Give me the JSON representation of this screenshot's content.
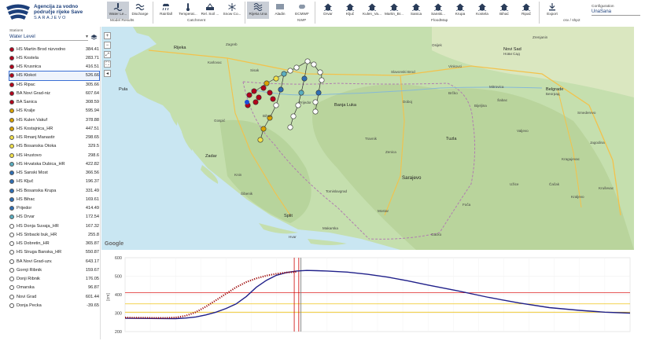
{
  "header": {
    "logo_line1": "Agencija za vodno",
    "logo_line2": "područje rijeke Save",
    "logo_sub": "SARAJEVO",
    "config_label": "Configuration",
    "config_value": "UnaSana"
  },
  "toolbar": {
    "buttons": [
      {
        "label": "Water Le...",
        "icon": "water-level-icon",
        "active": true
      },
      {
        "label": "Discharge",
        "icon": "discharge-icon",
        "active": false
      },
      {
        "label": "Rainfall",
        "icon": "rainfall-icon",
        "active": false
      },
      {
        "label": "Temperat...",
        "icon": "thermometer-icon",
        "active": false
      },
      {
        "label": "Rel. Soil ...",
        "icon": "soil-icon",
        "active": false
      },
      {
        "label": "Snow Co...",
        "icon": "snow-icon",
        "active": false
      },
      {
        "label": "Rijeka Una",
        "icon": "river-icon",
        "active": true
      },
      {
        "label": "Aladin",
        "icon": "aladin-icon",
        "active": false
      },
      {
        "label": "ECMWF",
        "icon": "ecmwf-icon",
        "active": false
      },
      {
        "label": "Drvar",
        "icon": "house-icon",
        "active": false
      },
      {
        "label": "Ključ",
        "icon": "house-icon",
        "active": false
      },
      {
        "label": "Kulen_Va...",
        "icon": "house-icon",
        "active": false
      },
      {
        "label": "Martin_Br...",
        "icon": "house-icon",
        "active": false
      },
      {
        "label": "Sanica",
        "icon": "house-icon",
        "active": false
      },
      {
        "label": "Sanski...",
        "icon": "house-icon",
        "active": false
      },
      {
        "label": "Krupa",
        "icon": "house-icon",
        "active": false
      },
      {
        "label": "Kostela",
        "icon": "house-icon",
        "active": false
      },
      {
        "label": "Bihać",
        "icon": "house-icon",
        "active": false
      },
      {
        "label": "Ripač",
        "icon": "house-icon",
        "active": false
      },
      {
        "label": "Export",
        "icon": "download-icon",
        "active": false
      }
    ],
    "groups": [
      "Model Results",
      "Catchment",
      "NWP",
      "FloodMap",
      "csv / shp2"
    ]
  },
  "sidebar": {
    "label": "Stations",
    "selected_type": "Water Level",
    "stations": [
      {
        "name": "HS Martin Brod nizvodno",
        "value": "384.41",
        "color": "#b3001b"
      },
      {
        "name": "HS Kostela",
        "value": "283.71",
        "color": "#b3001b"
      },
      {
        "name": "HS Krusnica",
        "value": "416.51",
        "color": "#b3001b"
      },
      {
        "name": "HS Klokot",
        "value": "526.66",
        "color": "#b3001b",
        "selected": true
      },
      {
        "name": "HS Ripac",
        "value": "305.66",
        "color": "#b3001b"
      },
      {
        "name": "BA Novi Grad-niz",
        "value": "607.64",
        "color": "#b3001b"
      },
      {
        "name": "BA Sanica",
        "value": "308.59",
        "color": "#b3001b"
      },
      {
        "name": "HS Kralje",
        "value": "595.94",
        "color": "#d9a200"
      },
      {
        "name": "HS Kulen Vakuf",
        "value": "378.88",
        "color": "#d9a200"
      },
      {
        "name": "HS Kostajnica_HR",
        "value": "447.51",
        "color": "#d9a200"
      },
      {
        "name": "HS Rmanj Manastir",
        "value": "298.65",
        "color": "#f1e04a"
      },
      {
        "name": "HS Bosanska Otoka",
        "value": "329.5",
        "color": "#f1e04a"
      },
      {
        "name": "HS Hrustovo",
        "value": "298.6",
        "color": "#f1e04a"
      },
      {
        "name": "HS Hrvatska Dubica_HR",
        "value": "422.82",
        "color": "#5aaec0"
      },
      {
        "name": "HS Sanski Most",
        "value": "366.56",
        "color": "#2f6fb5"
      },
      {
        "name": "HS Ključ",
        "value": "196.37",
        "color": "#2f6fb5"
      },
      {
        "name": "HS Bosanska Krupa",
        "value": "331.49",
        "color": "#2f6fb5"
      },
      {
        "name": "HS Bihac",
        "value": "169.61",
        "color": "#2f6fb5"
      },
      {
        "name": "Prijedor",
        "value": "414.49",
        "color": "#2f6fb5"
      },
      {
        "name": "HS Drvar",
        "value": "172.54",
        "color": "#5aaec0"
      },
      {
        "name": "HS Donja Suvaja_HR",
        "value": "167.32",
        "color": "#ffffff"
      },
      {
        "name": "HS Strbacki buk_HR",
        "value": "255.8",
        "color": "#ffffff"
      },
      {
        "name": "HS Dobretin_HR",
        "value": "365.87",
        "color": "#ffffff"
      },
      {
        "name": "HS Struga Banska_HR",
        "value": "550.87",
        "color": "#ffffff"
      },
      {
        "name": "BA Novi Grad-uzv.",
        "value": "643.17",
        "color": "#ffffff"
      },
      {
        "name": "Gornji Ribnik",
        "value": "159.67",
        "color": "#ffffff"
      },
      {
        "name": "Donji Ribnik",
        "value": "176.05",
        "color": "#ffffff"
      },
      {
        "name": "Omarska",
        "value": "96.87",
        "color": "#ffffff"
      },
      {
        "name": "Novi Grad",
        "value": "601.44",
        "color": "#ffffff"
      },
      {
        "name": "Donja Pecka",
        "value": "-39.65",
        "color": "#ffffff"
      }
    ]
  },
  "map": {
    "controls": [
      "+",
      "−",
      "⤢",
      "⛶",
      "◂"
    ],
    "labels": [
      {
        "t": "Rijeka",
        "x": 92,
        "y": 24,
        "c": "big"
      },
      {
        "t": "Pula",
        "x": 22,
        "y": 77,
        "c": "big"
      },
      {
        "t": "Zadar",
        "x": 132,
        "y": 162,
        "c": "big"
      },
      {
        "t": "Split",
        "x": 232,
        "y": 238,
        "c": "big"
      },
      {
        "t": "Banja Luka",
        "x": 296,
        "y": 97,
        "c": "big"
      },
      {
        "t": "Sarajevo",
        "x": 382,
        "y": 189,
        "c": "city"
      },
      {
        "t": "Novi Sad",
        "x": 511,
        "y": 26,
        "c": "big"
      },
      {
        "t": "Нови Сад",
        "x": 511,
        "y": 32,
        "c": ""
      },
      {
        "t": "Belgrade",
        "x": 565,
        "y": 77,
        "c": "big"
      },
      {
        "t": "Београд",
        "x": 565,
        "y": 83,
        "c": ""
      },
      {
        "t": "Zrenjanin",
        "x": 548,
        "y": 11,
        "c": ""
      },
      {
        "t": "Tuzla",
        "x": 438,
        "y": 140,
        "c": "big"
      },
      {
        "t": "Zenica",
        "x": 361,
        "y": 157,
        "c": ""
      },
      {
        "t": "Mostar",
        "x": 351,
        "y": 232,
        "c": ""
      },
      {
        "t": "Kragujevac",
        "x": 585,
        "y": 166,
        "c": ""
      },
      {
        "t": "Čačak",
        "x": 569,
        "y": 198,
        "c": ""
      },
      {
        "t": "Šabac",
        "x": 503,
        "y": 91,
        "c": ""
      },
      {
        "t": "Valjevo",
        "x": 528,
        "y": 130,
        "c": ""
      },
      {
        "t": "Bijeljina",
        "x": 474,
        "y": 98,
        "c": ""
      },
      {
        "t": "Brčko",
        "x": 441,
        "y": 82,
        "c": ""
      },
      {
        "t": "Doboj",
        "x": 383,
        "y": 93,
        "c": ""
      },
      {
        "t": "Prijedor",
        "x": 251,
        "y": 94,
        "c": ""
      },
      {
        "t": "Bihać",
        "x": 205,
        "y": 111,
        "c": ""
      },
      {
        "t": "Travnik",
        "x": 335,
        "y": 140,
        "c": ""
      },
      {
        "t": "Knin",
        "x": 169,
        "y": 186,
        "c": ""
      },
      {
        "t": "Šibenik",
        "x": 177,
        "y": 210,
        "c": ""
      },
      {
        "t": "Tomislavgrad",
        "x": 285,
        "y": 207,
        "c": ""
      },
      {
        "t": "Kraljevo",
        "x": 597,
        "y": 214,
        "c": ""
      },
      {
        "t": "Užice",
        "x": 519,
        "y": 198,
        "c": ""
      },
      {
        "t": "Osijek",
        "x": 420,
        "y": 21,
        "c": ""
      },
      {
        "t": "Karlovac",
        "x": 135,
        "y": 43,
        "c": ""
      },
      {
        "t": "Zagreb",
        "x": 158,
        "y": 20,
        "c": ""
      },
      {
        "t": "Sisak",
        "x": 189,
        "y": 53,
        "c": ""
      },
      {
        "t": "Gospić",
        "x": 143,
        "y": 117,
        "c": ""
      },
      {
        "t": "Slavonski Brod",
        "x": 368,
        "y": 55,
        "c": ""
      },
      {
        "t": "Vinkovci",
        "x": 441,
        "y": 48,
        "c": ""
      },
      {
        "t": "Mitrovica",
        "x": 493,
        "y": 74,
        "c": ""
      },
      {
        "t": "Smederevo",
        "x": 605,
        "y": 107,
        "c": ""
      },
      {
        "t": "Jagodina",
        "x": 621,
        "y": 145,
        "c": ""
      },
      {
        "t": "Kruševac",
        "x": 632,
        "y": 203,
        "c": ""
      },
      {
        "t": "Foča",
        "x": 459,
        "y": 224,
        "c": ""
      },
      {
        "t": "Gacko",
        "x": 419,
        "y": 262,
        "c": ""
      },
      {
        "t": "Makarska",
        "x": 281,
        "y": 254,
        "c": ""
      },
      {
        "t": "Hvar",
        "x": 238,
        "y": 265,
        "c": ""
      }
    ]
  },
  "chart_data": {
    "type": "line",
    "title": "",
    "xlabel": "",
    "ylabel": "[cm]",
    "ylim": [
      200,
      600
    ],
    "yticks": [
      200,
      300,
      400,
      500,
      600
    ],
    "xlim": [
      0,
      100
    ],
    "grid": true,
    "thresholds": [
      {
        "value": 410,
        "color": "#d22"
      },
      {
        "value": 350,
        "color": "#f0c419"
      },
      {
        "value": 305,
        "color": "#f0c419"
      }
    ],
    "vertical_markers": [
      {
        "x": 33.5,
        "color": "#c00"
      },
      {
        "x": 34.4,
        "color": "#c00"
      },
      {
        "x": 34.8,
        "color": "#777"
      }
    ],
    "series": [
      {
        "name": "",
        "color": "#20208a",
        "x": [
          0,
          5,
          10,
          12,
          14,
          16,
          18,
          20,
          22,
          24,
          26,
          28,
          30,
          32,
          34,
          36,
          38,
          40,
          44,
          48,
          52,
          56,
          60,
          66,
          72,
          78,
          84,
          90,
          95,
          100
        ],
        "y": [
          272,
          271,
          270,
          273,
          279,
          290,
          305,
          325,
          350,
          390,
          440,
          478,
          505,
          520,
          528,
          531,
          530,
          528,
          522,
          510,
          495,
          475,
          452,
          420,
          385,
          355,
          330,
          315,
          305,
          300
        ]
      },
      {
        "name": "",
        "color": "#a01010",
        "style": "dotted",
        "x": [
          0,
          2,
          4,
          6,
          8,
          10,
          12,
          14,
          16,
          18,
          20,
          22,
          24,
          26,
          28,
          30,
          32,
          34
        ],
        "y": [
          276,
          275,
          275,
          274,
          274,
          276,
          285,
          305,
          335,
          370,
          405,
          440,
          468,
          488,
          503,
          513,
          520,
          524
        ]
      }
    ]
  }
}
